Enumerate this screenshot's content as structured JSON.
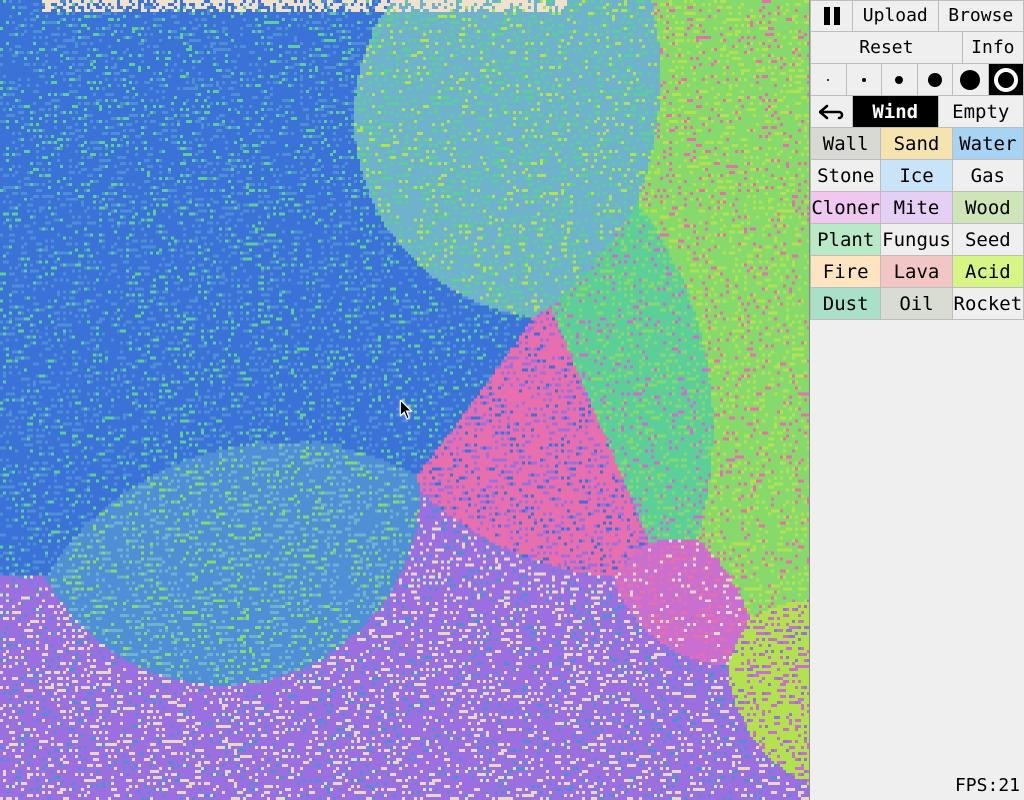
{
  "controls": {
    "pause_icon": "pause",
    "upload": "Upload",
    "browse": "Browse",
    "reset": "Reset",
    "info": "Info",
    "undo": "↩",
    "wind": "Wind",
    "empty": "Empty"
  },
  "brush_sizes": [
    2,
    4,
    8,
    14,
    20
  ],
  "brush_selected_index": 5,
  "selected_tool": "Wind",
  "elements": [
    {
      "label": "Wall",
      "color": "#d8d8d4"
    },
    {
      "label": "Sand",
      "color": "#f5e3b0"
    },
    {
      "label": "Water",
      "color": "#a9d3f2"
    },
    {
      "label": "Stone",
      "color": "#efefef"
    },
    {
      "label": "Ice",
      "color": "#c9e3f8"
    },
    {
      "label": "Gas",
      "color": "#efefef"
    },
    {
      "label": "Cloner",
      "color": "#efc7ef"
    },
    {
      "label": "Mite",
      "color": "#e6cff5"
    },
    {
      "label": "Wood",
      "color": "#cfe5b8"
    },
    {
      "label": "Plant",
      "color": "#b8eac7"
    },
    {
      "label": "Fungus",
      "color": "#efefef"
    },
    {
      "label": "Seed",
      "color": "#efefef"
    },
    {
      "label": "Fire",
      "color": "#ffe4c2"
    },
    {
      "label": "Lava",
      "color": "#f3c6c6"
    },
    {
      "label": "Acid",
      "color": "#d6f585"
    },
    {
      "label": "Dust",
      "color": "#a9e0c7"
    },
    {
      "label": "Oil",
      "color": "#d9dcd2"
    },
    {
      "label": "Rocket",
      "color": "#efefef"
    }
  ],
  "fps_label": "FPS:",
  "fps_value": "21",
  "canvas_palette": [
    "#3a72d8",
    "#4f8fd6",
    "#6fb2cc",
    "#5ccf98",
    "#86d96b",
    "#b3e24f",
    "#c96fcf",
    "#e86fae",
    "#9b6fe0",
    "#e8d9c2"
  ]
}
